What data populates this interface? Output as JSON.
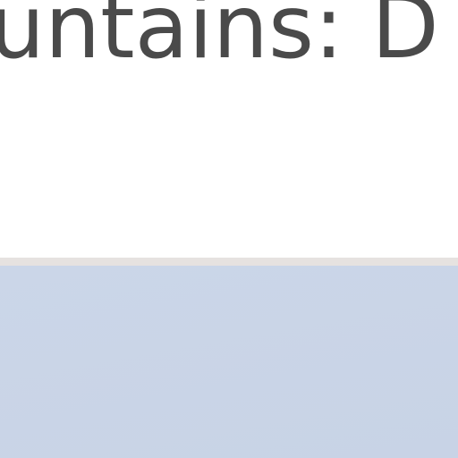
{
  "page": {
    "heading": "ountains: D"
  },
  "colors": {
    "background": "#ffffff",
    "heading_text": "#4a4a4a",
    "divider": "#e6e2e0",
    "band": "#cbd6e8"
  }
}
